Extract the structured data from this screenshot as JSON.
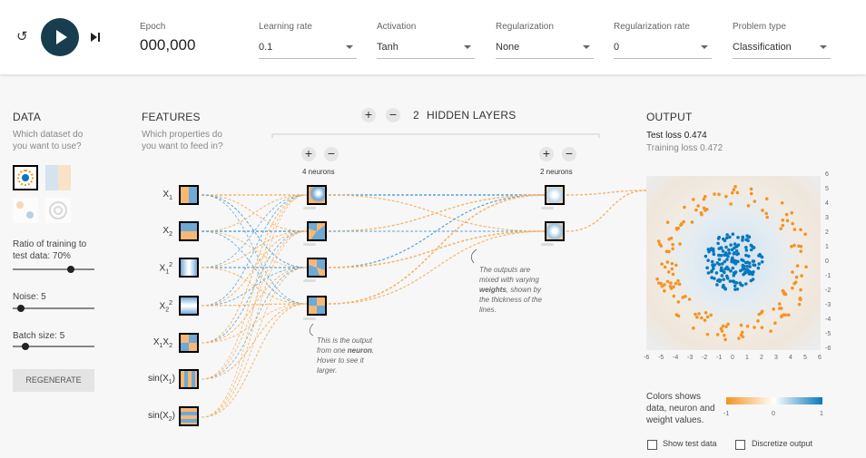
{
  "controls": {
    "epoch_label": "Epoch",
    "epoch_value": "000,000",
    "learning_rate": {
      "label": "Learning rate",
      "value": "0.1"
    },
    "activation": {
      "label": "Activation",
      "value": "Tanh"
    },
    "regularization": {
      "label": "Regularization",
      "value": "None"
    },
    "regularization_rate": {
      "label": "Regularization rate",
      "value": "0"
    },
    "problem_type": {
      "label": "Problem type",
      "value": "Classification"
    }
  },
  "data_panel": {
    "heading": "DATA",
    "subtitle": "Which dataset do you want to use?",
    "ratio_label": "Ratio of training to test data:",
    "ratio_value": "70%",
    "ratio_fraction": 0.7,
    "noise_label": "Noise:",
    "noise_value": "5",
    "noise_fraction": 0.1,
    "batch_label": "Batch size:",
    "batch_value": "5",
    "batch_fraction": 0.13,
    "regenerate": "REGENERATE"
  },
  "features_panel": {
    "heading": "FEATURES",
    "subtitle": "Which properties do you want to feed in?",
    "features": [
      "X1",
      "X2",
      "X1²",
      "X2²",
      "X1X2",
      "sin(X1)",
      "sin(X2)"
    ]
  },
  "hidden": {
    "count": "2",
    "label": "HIDDEN LAYERS",
    "layer1_neurons": "4 neurons",
    "layer2_neurons": "2 neurons",
    "note1": "This is the output from one neuron. Hover to see it larger.",
    "note1_bold": "neuron",
    "note2": "The outputs are mixed with varying weights, shown by the thickness of the lines."
  },
  "output_panel": {
    "heading": "OUTPUT",
    "test_loss_label": "Test loss",
    "test_loss_value": "0.474",
    "training_loss_label": "Training loss",
    "training_loss_value": "0.472",
    "colors_caption": "Colors shows data, neuron and weight values.",
    "legend_ticks": [
      "-1",
      "0",
      "1"
    ],
    "y_ticks": [
      "6",
      "5",
      "4",
      "3",
      "2",
      "1",
      "0",
      "-1",
      "-2",
      "-3",
      "-4",
      "-5",
      "-6"
    ],
    "x_ticks": [
      "-6",
      "-5",
      "-4",
      "-3",
      "-2",
      "-1",
      "0",
      "1",
      "2",
      "3",
      "4",
      "5",
      "6"
    ],
    "show_test": "Show test data",
    "discretize": "Discretize output",
    "orange": "#f59322",
    "blue": "#0877bd"
  }
}
